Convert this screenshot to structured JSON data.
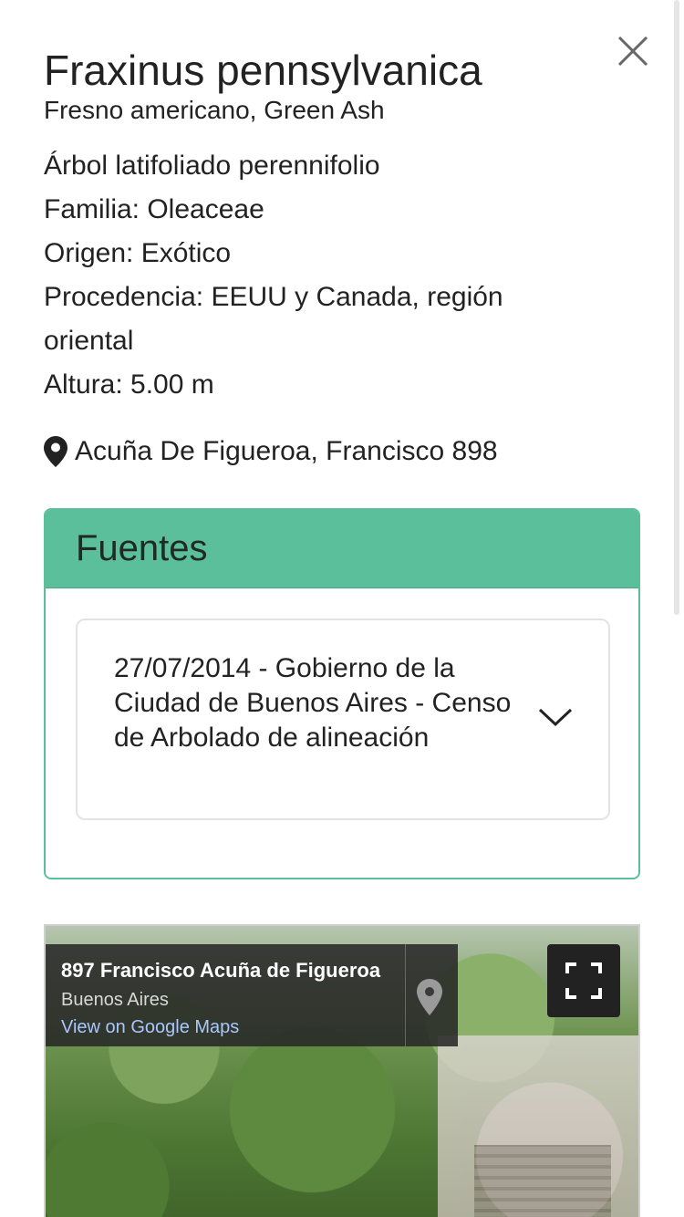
{
  "header": {
    "title": "Fraxinus pennsylvanica",
    "subtitle": "Fresno americano, Green Ash"
  },
  "details": {
    "type": "Árbol latifoliado perennifolio",
    "family": "Familia: Oleaceae",
    "origin": "Origen: Exótico",
    "provenance": "Procedencia: EEUU y Canada, región oriental",
    "height": "Altura: 5.00 m"
  },
  "location": {
    "icon": "map-pin-icon",
    "address": "Acuña De Figueroa, Francisco 898"
  },
  "sources": {
    "heading": "Fuentes",
    "items": [
      {
        "label": "27/07/2014 - Gobierno de la Ciudad de Buenos Aires - Censo de Arbolado de alineación"
      }
    ],
    "accent_color": "#5bbf9c"
  },
  "streetview": {
    "place_title": "897 Francisco Acuña de Figueroa",
    "place_subtitle": "Buenos Aires",
    "link_text": "View on Google Maps"
  },
  "icons": {
    "close": "close-icon",
    "expand": "chevron-down-icon",
    "fullscreen": "fullscreen-icon"
  }
}
